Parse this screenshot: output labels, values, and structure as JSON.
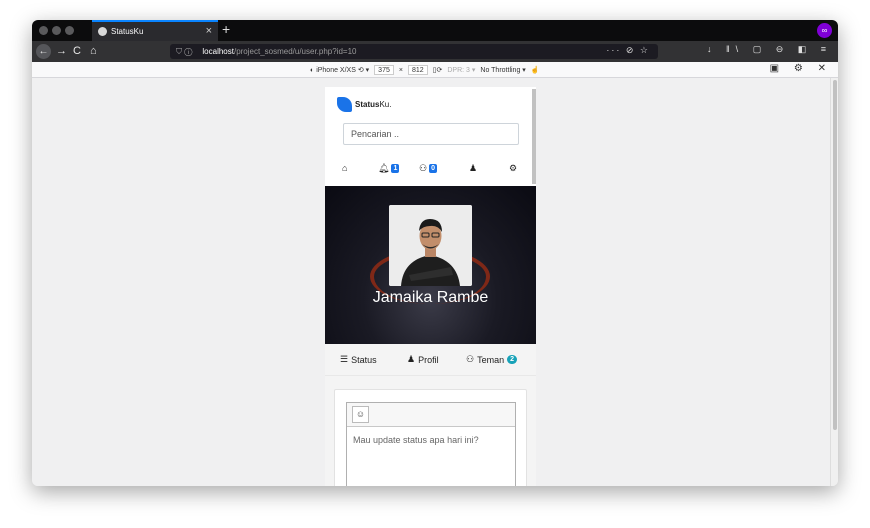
{
  "browser": {
    "tab_title": "StatusKu",
    "tab_close": "×",
    "new_tab": "+",
    "back": "←",
    "forward": "→",
    "reload": "C",
    "home": "⌂",
    "url_host": "localhost",
    "url_path": "/project_sosmed/u/user.php?id=10",
    "url_actions": "··· ⊘ ☆",
    "toolbar_icons": "↓ ‖\\ ▢ ⊖ ◧ ≡",
    "extension_label": "∞"
  },
  "rdm": {
    "device": "iPhone X/XS",
    "width": "375",
    "times": "×",
    "height": "812",
    "dpr": "DPR: 3",
    "throttle": "No Throttling",
    "right_icons": "▣ ⚙ ✕"
  },
  "app": {
    "brand_bold": "Status",
    "brand_rest": "Ku.",
    "search_placeholder": "Pencarian ..",
    "menu": {
      "home_icon": "⌂",
      "notif_icon": "♠",
      "notif_count": "1",
      "friends_icon": "⚇",
      "friends_count": "0",
      "user_icon": "♟",
      "settings_icon": "⚙"
    },
    "profile_name": "Jamaika Rambe",
    "tabs": {
      "status": "Status",
      "profil": "Profil",
      "teman": "Teman",
      "teman_count": "2"
    },
    "composer": {
      "emoji": "☺",
      "placeholder": "Mau update status apa hari ini?"
    }
  }
}
